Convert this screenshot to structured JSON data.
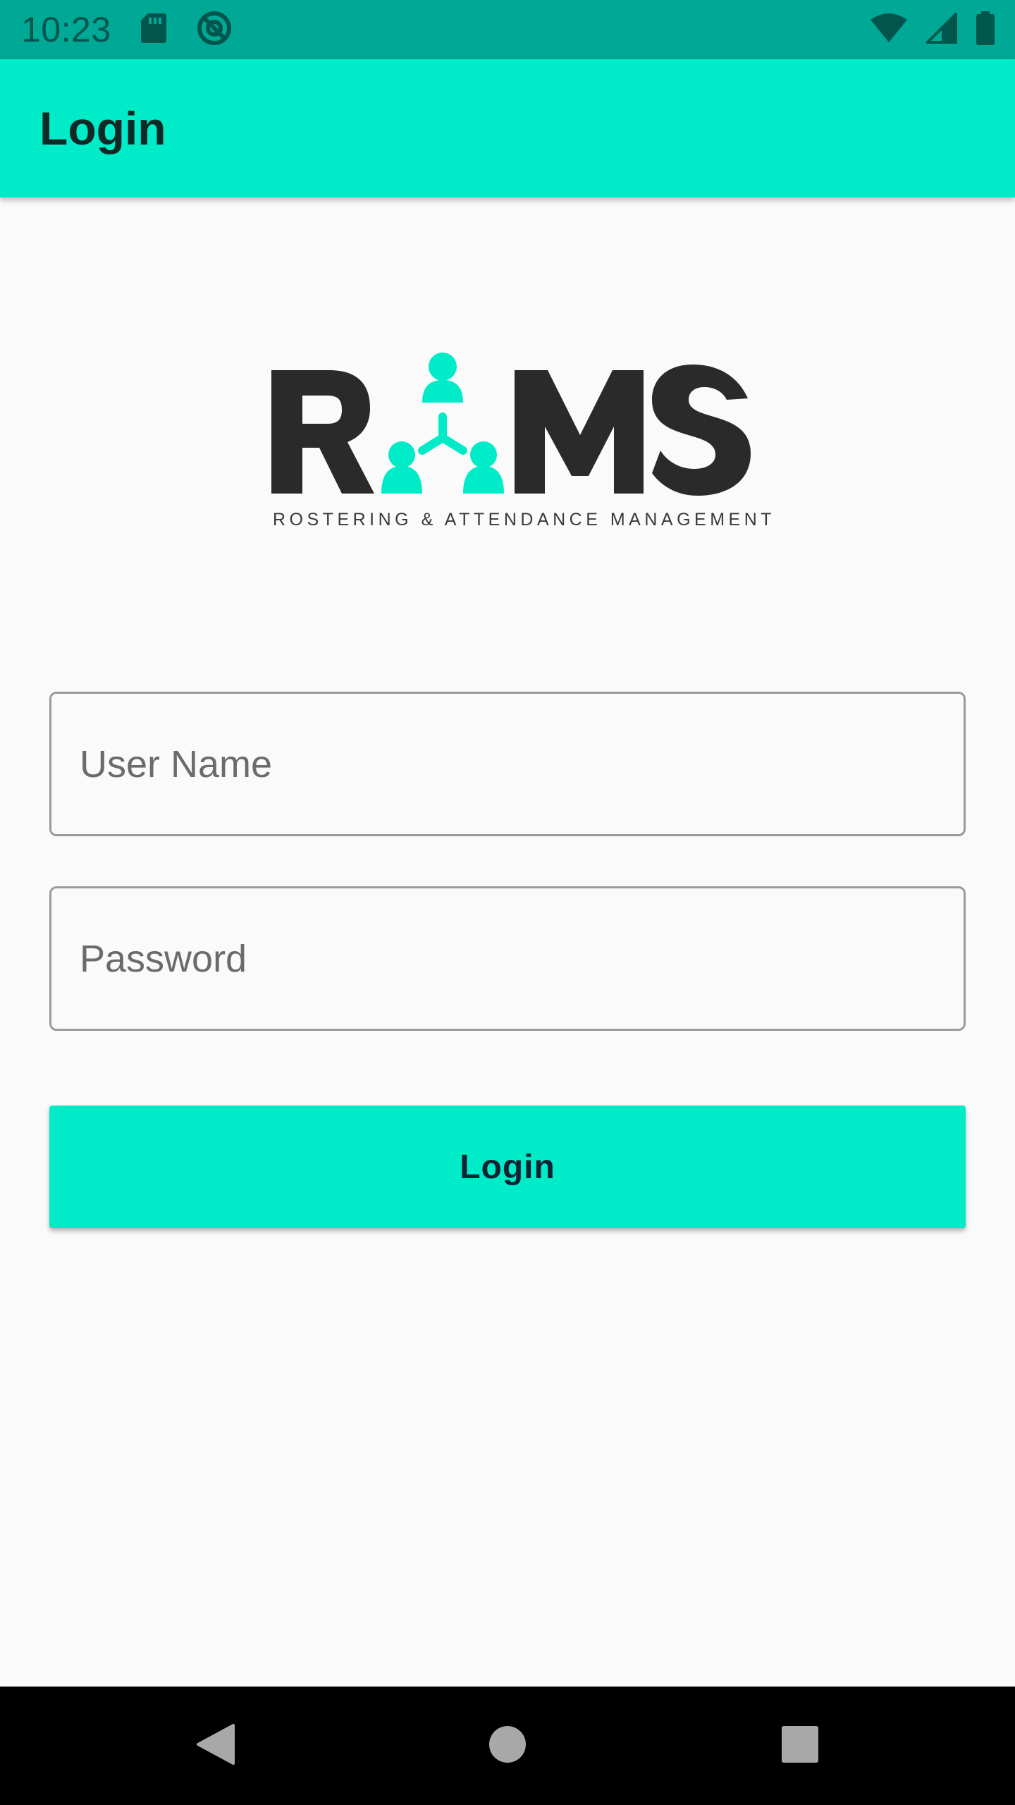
{
  "status_bar": {
    "time": "10:23",
    "left_icons": [
      "sd-card-icon",
      "do-not-disturb-icon"
    ],
    "right_icons": [
      "wifi-icon",
      "cell-signal-icon",
      "battery-icon"
    ]
  },
  "app_bar": {
    "title": "Login"
  },
  "logo": {
    "wordmark": "RAMS",
    "tagline": "ROSTERING & ATTENDANCE MANAGEMENT"
  },
  "form": {
    "username": {
      "placeholder": "User Name",
      "value": ""
    },
    "password": {
      "placeholder": "Password",
      "value": ""
    },
    "login_label": "Login"
  },
  "nav_bar": {
    "buttons": [
      "back-icon",
      "home-icon",
      "recents-icon"
    ]
  },
  "colors": {
    "status_bar": "#00a896",
    "accent": "#00ebc7",
    "logo_dark": "#2a2a2a",
    "background": "#fafafa"
  }
}
